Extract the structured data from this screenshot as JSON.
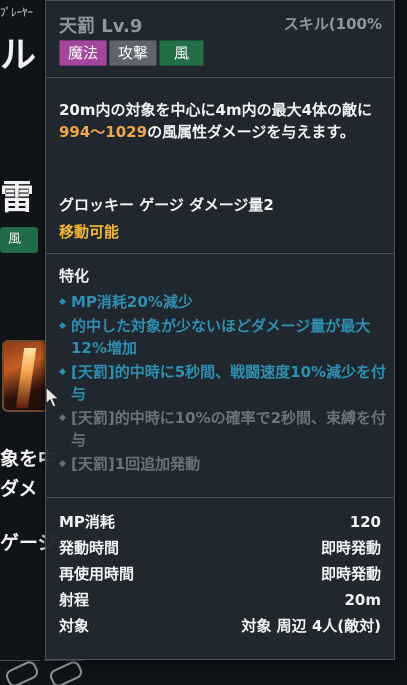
{
  "background": {
    "player_label": "ﾌﾟﾚｰﾔｰ",
    "big_char_1": "ル",
    "thunder_char": "雷",
    "wind_badge": "風",
    "text_line_1": "象を中",
    "text_line_2": "ダメ",
    "text_line_3": "ゲージ"
  },
  "tooltip": {
    "title": "天罰 Lv.9",
    "header_right": "スキル(100%",
    "tags": [
      "魔法",
      "攻撃",
      "風"
    ],
    "description": {
      "prefix": "20m内の対象を中心に4m内の最大4体の敵に",
      "damage": "994〜1029",
      "suffix": "の風属性ダメージを与えます。"
    },
    "groggy": "グロッキー ゲージ ダメージ量2",
    "movable": "移動可能",
    "specialization": {
      "title": "特化",
      "items": [
        {
          "text": "MP消耗20%減少",
          "active": true
        },
        {
          "text": "的中した対象が少ないほどダメージ量が最大12%増加",
          "active": true
        },
        {
          "text": "[天罰]的中時に5秒間、戦闘速度10%減少を付与",
          "active": true
        },
        {
          "text": "[天罰]的中時に10%の確率で2秒間、束縛を付与",
          "active": false
        },
        {
          "text": "[天罰]1回追加発動",
          "active": false
        }
      ]
    },
    "stats": [
      {
        "label": "MP消耗",
        "value": "120"
      },
      {
        "label": "発動時間",
        "value": "即時発動"
      },
      {
        "label": "再使用時間",
        "value": "即時発動"
      },
      {
        "label": "射程",
        "value": "20m"
      },
      {
        "label": "対象",
        "value": "対象 周辺 4人(敵対)"
      }
    ]
  },
  "icons": {
    "bullet": "diamond-bullet-icon",
    "cursor": "mouse-cursor-icon"
  },
  "colors": {
    "tag_magic": "#a3479c",
    "tag_attack": "#5e646b",
    "tag_wind": "#237048",
    "damage_highlight": "#f0a64b",
    "movable": "#f5b82e",
    "spec_active": "#2f8fb0",
    "spec_inactive": "#6a737c"
  }
}
